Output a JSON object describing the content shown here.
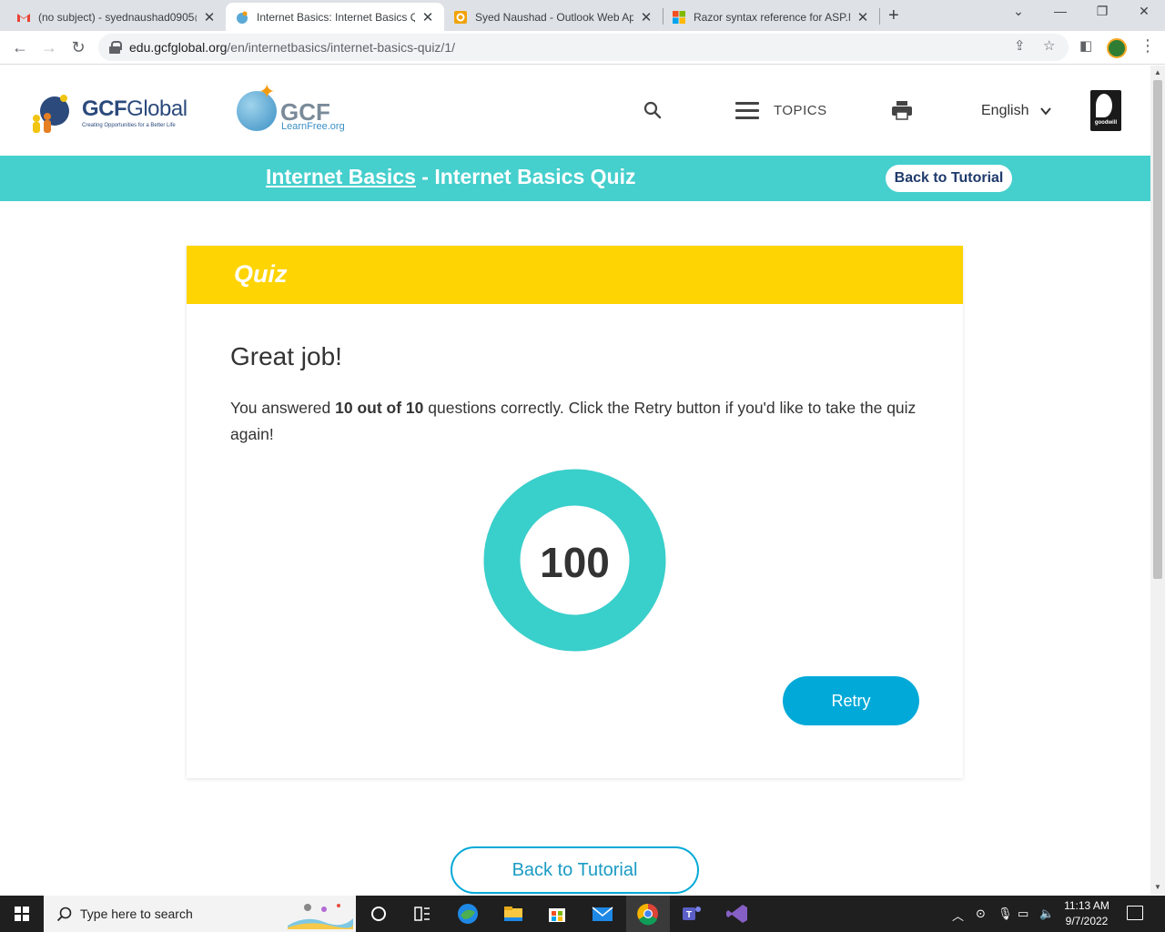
{
  "browser": {
    "tabs": [
      {
        "title": "(no subject) - syednaushad0905@",
        "icon": "gmail-icon",
        "active": false
      },
      {
        "title": "Internet Basics: Internet Basics Qu",
        "icon": "gcf-globe-icon",
        "active": true
      },
      {
        "title": "Syed Naushad - Outlook Web Ap",
        "icon": "outlook-icon",
        "active": false
      },
      {
        "title": "Razor syntax reference for ASP.N",
        "icon": "microsoft-icon",
        "active": false
      }
    ],
    "url_host": "edu.gcfglobal.org",
    "url_path": "/en/internetbasics/internet-basics-quiz/1/"
  },
  "site": {
    "logo_brand_bold": "GCF",
    "logo_brand_light": "Global",
    "logo_tagline": "Creating Opportunities for a Better Life",
    "logo2_big": "GCF",
    "logo2_small": "LearnFree.org",
    "topics_label": "TOPICS",
    "language": "English",
    "goodwill_label": "goodwill"
  },
  "crumb": {
    "course_link": "Internet Basics",
    "separator": " - ",
    "page_title": "Internet Basics Quiz",
    "back_button": "Back to Tutorial"
  },
  "quiz": {
    "header": "Quiz",
    "result_title": "Great job!",
    "result_prefix": "You answered ",
    "result_score_text": "10 out of 10",
    "result_suffix": " questions correctly. Click the Retry button if you'd like to take the quiz again!",
    "score": "100",
    "score_fraction": 1.0,
    "retry_label": "Retry",
    "bottom_back_label": "Back to Tutorial"
  },
  "taskbar": {
    "search_placeholder": "Type here to search",
    "time": "11:13 AM",
    "date": "9/7/2022"
  },
  "colors": {
    "teal": "#45cfcd",
    "quiz_yellow": "#fed403",
    "retry_blue": "#00a9d8",
    "donut_teal": "#39cfcb"
  }
}
